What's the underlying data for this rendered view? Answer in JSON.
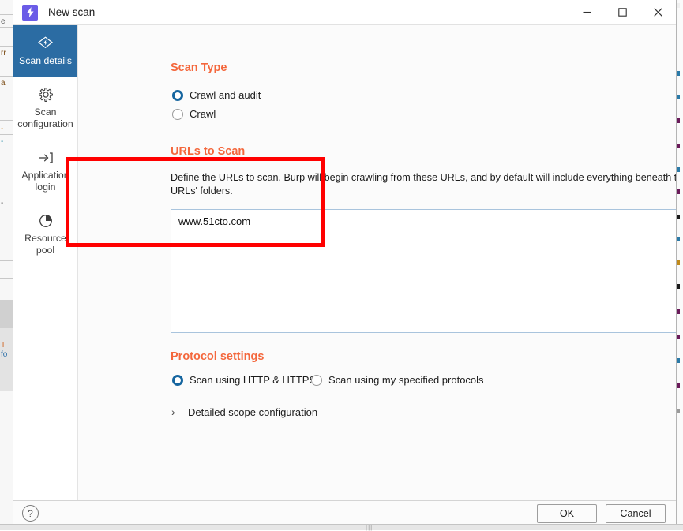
{
  "window": {
    "title": "New scan",
    "app_icon": "lightning-bolt-icon",
    "minimize_label": "—",
    "maximize_label": "□",
    "close_label": "✕"
  },
  "sidebar": {
    "items": [
      {
        "label": "Scan details",
        "icon": "scan-flag-icon",
        "active": true
      },
      {
        "label": "Scan configuration",
        "icon": "gear-icon",
        "active": false
      },
      {
        "label": "Application login",
        "icon": "login-arrow-icon",
        "active": false
      },
      {
        "label": "Resource pool",
        "icon": "pie-chart-icon",
        "active": false
      }
    ]
  },
  "main": {
    "scan_type": {
      "heading": "Scan Type",
      "options": [
        {
          "label": "Crawl and audit",
          "selected": true
        },
        {
          "label": "Crawl",
          "selected": false
        }
      ]
    },
    "urls_to_scan": {
      "heading": "URLs to Scan",
      "description": "Define the URLs to scan. Burp will begin crawling from these URLs, and by default will include everything beneath the specified URLs' folders.",
      "textarea_value": "www.51cto.com",
      "textarea_placeholder": ""
    },
    "protocol_settings": {
      "heading": "Protocol settings",
      "options": [
        {
          "label": "Scan using HTTP & HTTPS",
          "selected": true
        },
        {
          "label": "Scan using my specified protocols",
          "selected": false
        }
      ]
    },
    "detailed_scope": {
      "label": "Detailed scope configuration",
      "chevron": "›",
      "expanded": false
    }
  },
  "footer": {
    "help_label": "?",
    "ok_label": "OK",
    "cancel_label": "Cancel"
  },
  "annotation": {
    "type": "highlight-rectangle",
    "color": "#ff0000"
  },
  "colors": {
    "heading_orange": "#f4673c",
    "sidebar_active_blue": "#2b6ca3",
    "radio_selected_blue": "#15659f",
    "app_icon_purple": "#6b5ce7",
    "textarea_border": "#a9c4dd"
  }
}
